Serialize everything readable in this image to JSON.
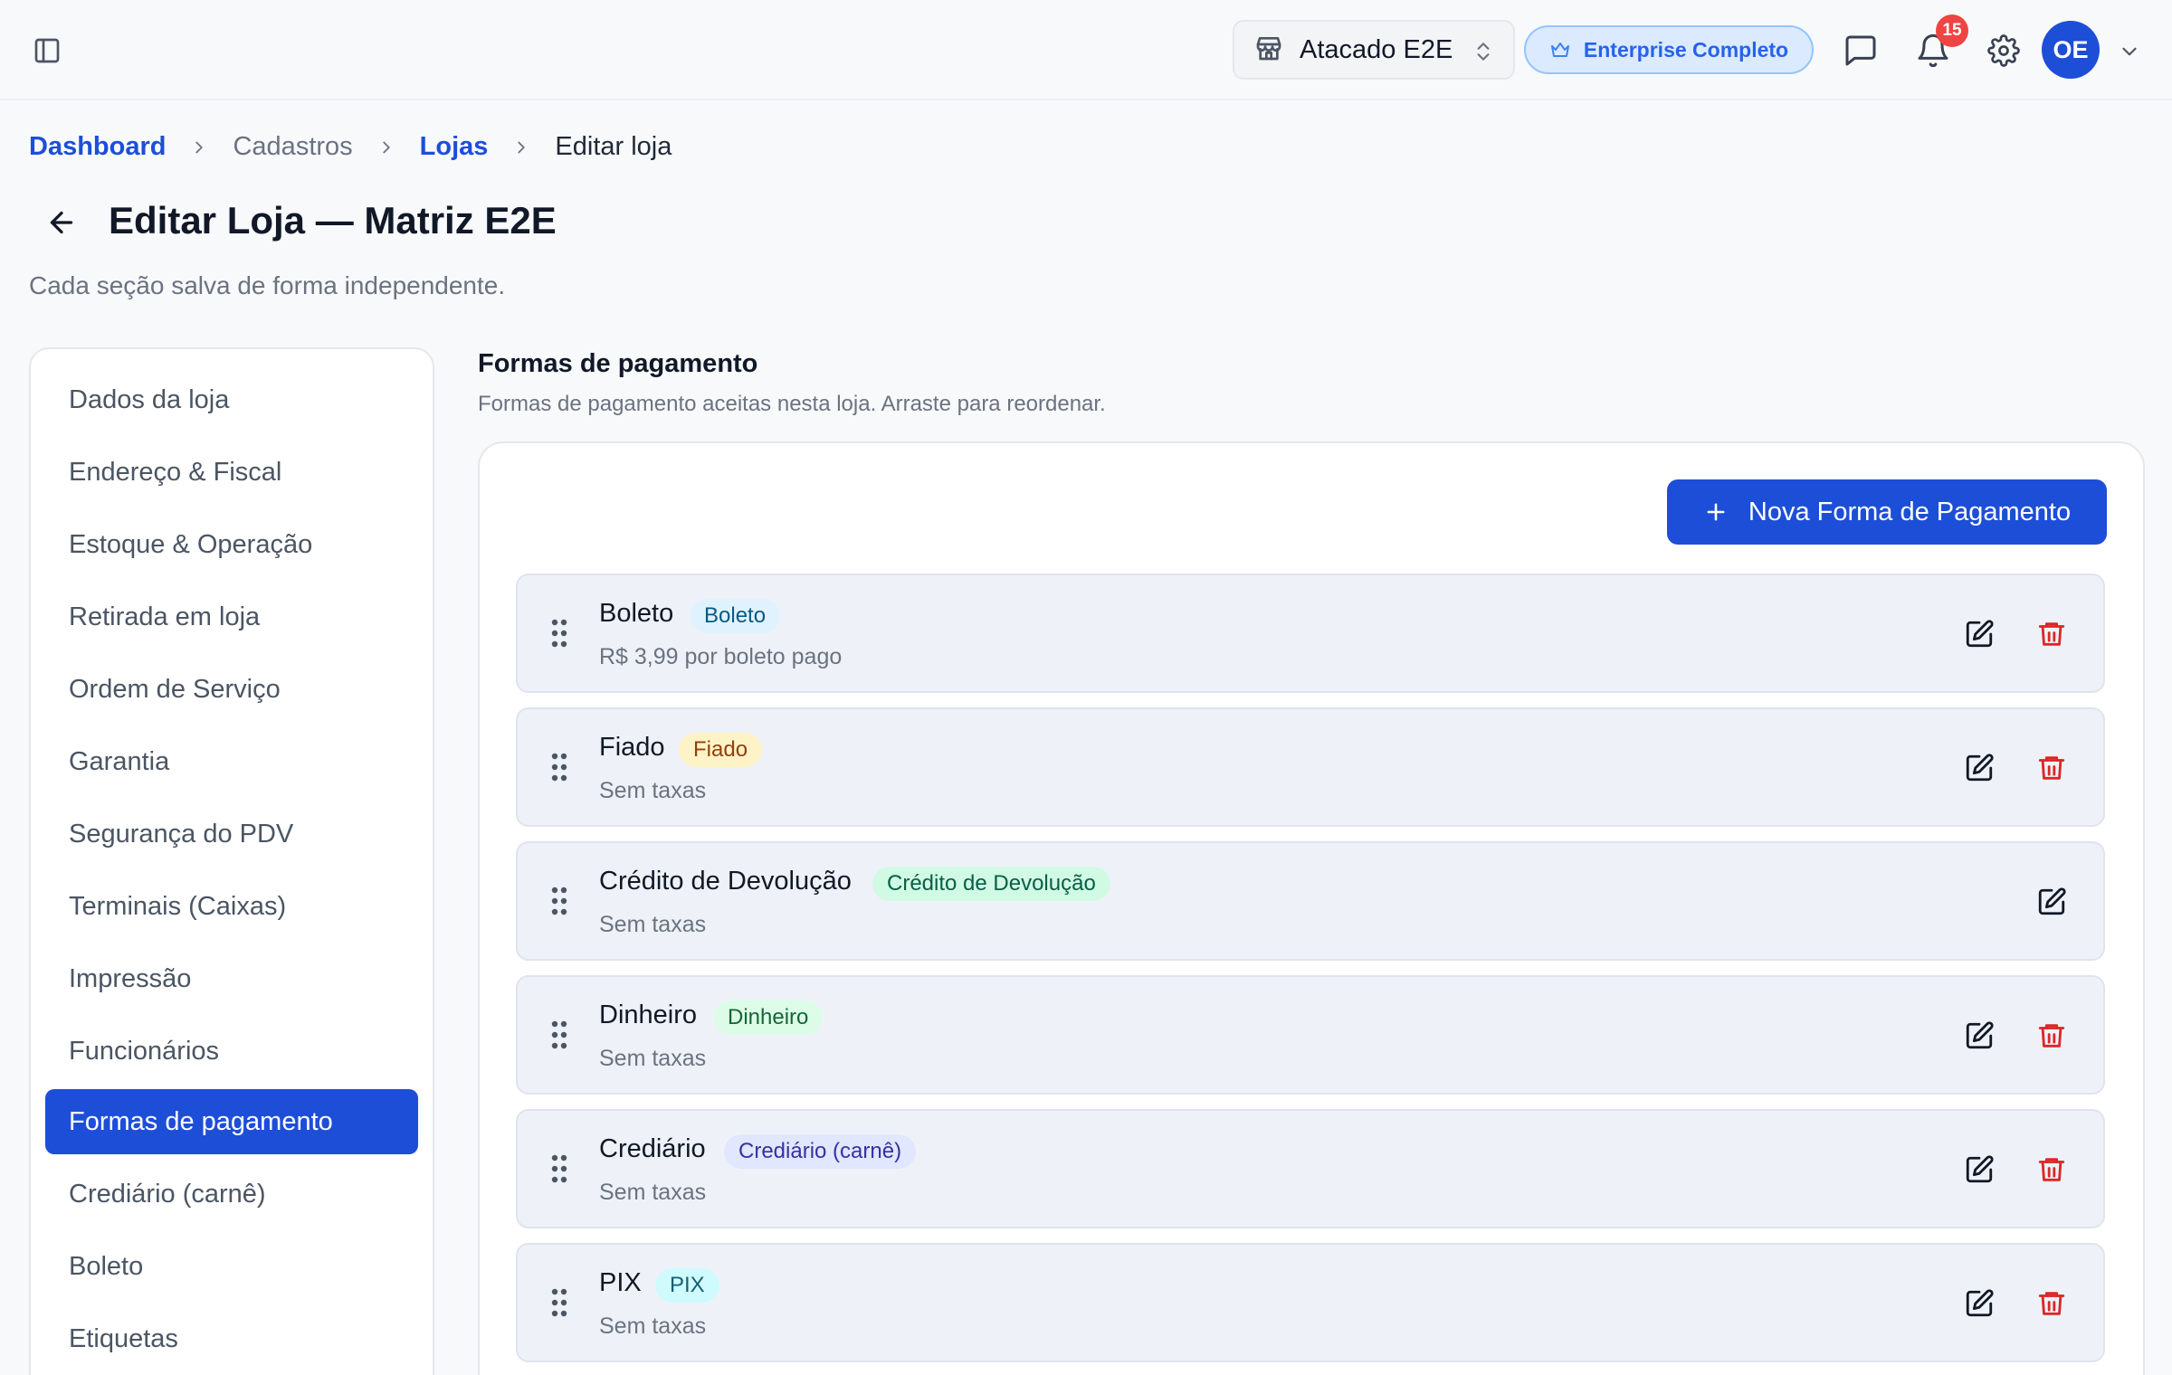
{
  "header": {
    "store_name": "Atacado E2E",
    "plan_label": "Enterprise Completo",
    "notifications_count": "15",
    "avatar_initials": "OE"
  },
  "breadcrumb": {
    "items": [
      "Dashboard",
      "Cadastros",
      "Lojas",
      "Editar loja"
    ]
  },
  "page": {
    "title": "Editar Loja — Matriz E2E",
    "subtitle": "Cada seção salva de forma independente."
  },
  "nav": {
    "items": [
      "Dados da loja",
      "Endereço & Fiscal",
      "Estoque & Operação",
      "Retirada em loja",
      "Ordem de Serviço",
      "Garantia",
      "Segurança do PDV",
      "Terminais (Caixas)",
      "Impressão",
      "Funcionários",
      "Formas de pagamento",
      "Crediário (carnê)",
      "Boleto",
      "Etiquetas"
    ],
    "active": "Formas de pagamento"
  },
  "section": {
    "title": "Formas de pagamento",
    "description": "Formas de pagamento aceitas nesta loja. Arraste para reordenar.",
    "new_button_label": "Nova Forma de Pagamento"
  },
  "payment_methods": [
    {
      "name": "Boleto",
      "tag": "Boleto",
      "fee": "R$ 3,99 por boleto pago",
      "tag_bg": "#e0f2fe",
      "tag_fg": "#075985",
      "deletable": true
    },
    {
      "name": "Fiado",
      "tag": "Fiado",
      "fee": "Sem taxas",
      "tag_bg": "#fef3c7",
      "tag_fg": "#92400e",
      "deletable": true
    },
    {
      "name": "Crédito de Devolução",
      "tag": "Crédito de Devolução",
      "fee": "Sem taxas",
      "tag_bg": "#d1fae5",
      "tag_fg": "#065f46",
      "deletable": false
    },
    {
      "name": "Dinheiro",
      "tag": "Dinheiro",
      "fee": "Sem taxas",
      "tag_bg": "#dcfce7",
      "tag_fg": "#166534",
      "deletable": true
    },
    {
      "name": "Crediário",
      "tag": "Crediário (carnê)",
      "fee": "Sem taxas",
      "tag_bg": "#e0e7ff",
      "tag_fg": "#3730a3",
      "deletable": true
    },
    {
      "name": "PIX",
      "tag": "PIX",
      "fee": "Sem taxas",
      "tag_bg": "#cffafe",
      "tag_fg": "#155e75",
      "deletable": true
    }
  ],
  "colors": {
    "primary": "#1d4ed8",
    "danger": "#dc2626",
    "notification": "#ef4444"
  }
}
